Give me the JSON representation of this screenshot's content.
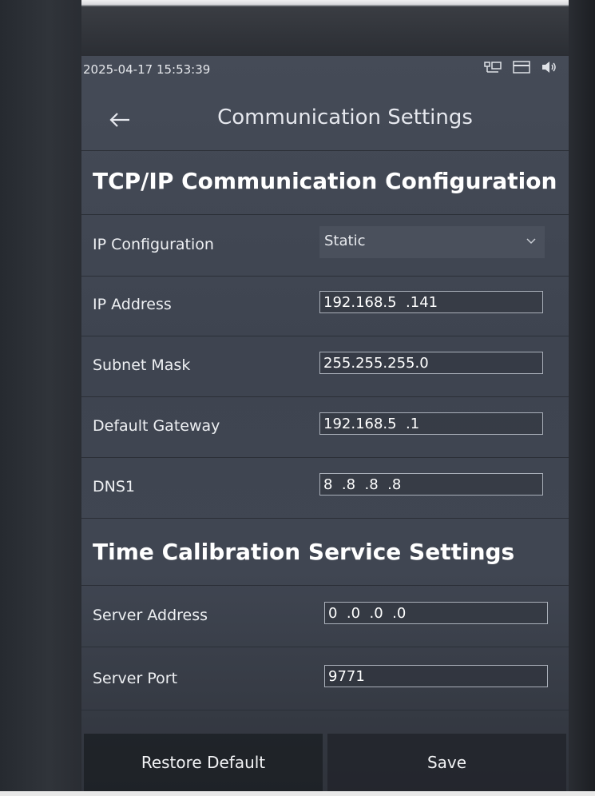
{
  "status_bar": {
    "datetime": "2025-04-17 15:53:39",
    "icons": [
      "network-icon",
      "card-icon",
      "volume-icon"
    ]
  },
  "header": {
    "title": "Communication Settings",
    "back_icon": "back-arrow-icon"
  },
  "tcpip": {
    "section_title": "TCP/IP Communication Configuration",
    "ip_configuration": {
      "label": "IP Configuration",
      "value": "Static"
    },
    "ip_address": {
      "label": "IP Address",
      "value": "192.168.5  .141"
    },
    "subnet_mask": {
      "label": "Subnet Mask",
      "value": "255.255.255.0"
    },
    "default_gateway": {
      "label": "Default Gateway",
      "value": "192.168.5  .1"
    },
    "dns1": {
      "label": "DNS1",
      "value": "8  .8  .8  .8"
    }
  },
  "time_calibration": {
    "section_title": "Time Calibration Service Settings",
    "server_address": {
      "label": "Server Address",
      "value": "0  .0  .0  .0"
    },
    "server_port": {
      "label": "Server Port",
      "value": "9771"
    }
  },
  "footer": {
    "restore_label": "Restore Default",
    "save_label": "Save"
  }
}
